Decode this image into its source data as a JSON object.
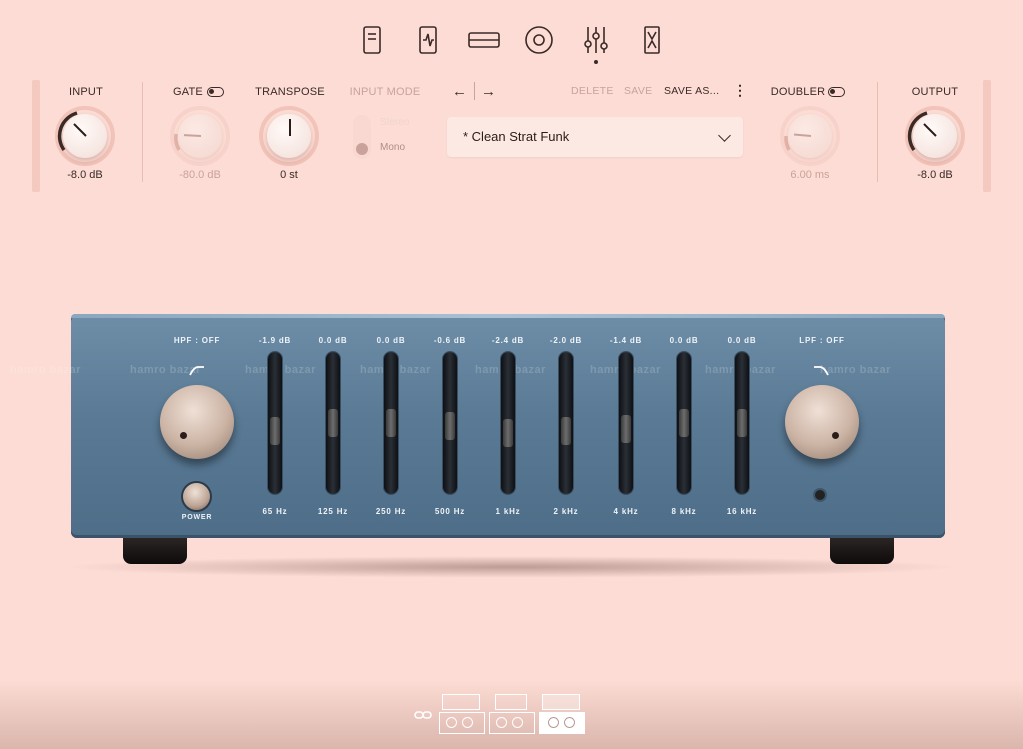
{
  "nav": {
    "items": [
      "pedal-icon",
      "stompbox-icon",
      "amp-icon",
      "speaker-icon",
      "eq-sliders-icon",
      "hourglass-icon"
    ],
    "active": "eq-sliders-icon"
  },
  "controls": {
    "input": {
      "label": "INPUT",
      "value": "-8.0 dB"
    },
    "gate": {
      "label": "GATE",
      "value": "-80.0 dB"
    },
    "transpose": {
      "label": "TRANSPOSE",
      "value": "0 st"
    },
    "input_mode": {
      "label": "INPUT MODE",
      "options": [
        "Stereo",
        "Mono"
      ],
      "selected": "Mono"
    },
    "preset": {
      "name": "* Clean Strat Funk",
      "delete": "DELETE",
      "save": "SAVE",
      "save_as": "SAVE AS...",
      "more": "⋮",
      "prev": "←",
      "next": "→"
    },
    "doubler": {
      "label": "DOUBLER",
      "value": "6.00 ms"
    },
    "output": {
      "label": "OUTPUT",
      "value": "-8.0 dB"
    }
  },
  "eq": {
    "hpf": "HPF : OFF",
    "lpf": "LPF : OFF",
    "power_label": "POWER",
    "watermark": "hamro bazar",
    "bands": [
      {
        "freq": "65 Hz",
        "gain": "-1.9 dB",
        "level": -1.9
      },
      {
        "freq": "125 Hz",
        "gain": "0.0 dB",
        "level": 0.0
      },
      {
        "freq": "250 Hz",
        "gain": "0.0 dB",
        "level": 0.0
      },
      {
        "freq": "500 Hz",
        "gain": "-0.6 dB",
        "level": -0.6
      },
      {
        "freq": "1 kHz",
        "gain": "-2.4 dB",
        "level": -2.4
      },
      {
        "freq": "2 kHz",
        "gain": "-2.0 dB",
        "level": -2.0
      },
      {
        "freq": "4 kHz",
        "gain": "-1.4 dB",
        "level": -1.4
      },
      {
        "freq": "8 kHz",
        "gain": "0.0 dB",
        "level": 0.0
      },
      {
        "freq": "16 kHz",
        "gain": "0.0 dB",
        "level": 0.0
      }
    ]
  },
  "bottom": {
    "racks": [
      "rack-1",
      "rack-2",
      "rack-3"
    ],
    "selected": 2
  }
}
